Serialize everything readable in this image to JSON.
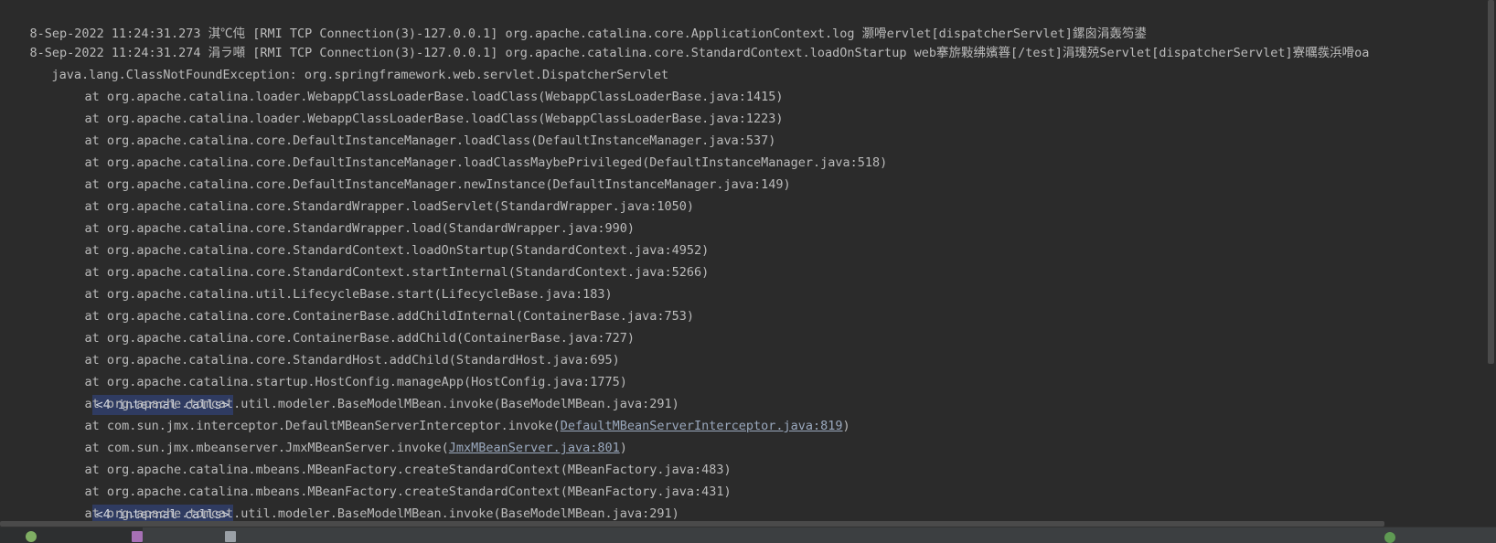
{
  "console": {
    "lines": [
      "8-Sep-2022 11:24:31.273 淇℃伅 [RMI TCP Connection(3)-127.0.0.1] org.apache.catalina.core.ApplicationContext.log 灏嗗ervlet[dispatcherServlet]鏍囪涓轰笉鍙",
      "8-Sep-2022 11:24:31.274 涓ラ噸 [RMI TCP Connection(3)-127.0.0.1] org.apache.catalina.core.StandardContext.loadOnStartup web搴旂敤绋嬪簭[/test]涓瑰殑Servlet[dispatcherServlet]寮曞彂浜嗗oa",
      "java.lang.ClassNotFoundException: org.springframework.web.servlet.DispatcherServlet",
      "at org.apache.catalina.loader.WebappClassLoaderBase.loadClass(WebappClassLoaderBase.java:1415)",
      "at org.apache.catalina.loader.WebappClassLoaderBase.loadClass(WebappClassLoaderBase.java:1223)",
      "at org.apache.catalina.core.DefaultInstanceManager.loadClass(DefaultInstanceManager.java:537)",
      "at org.apache.catalina.core.DefaultInstanceManager.loadClassMaybePrivileged(DefaultInstanceManager.java:518)",
      "at org.apache.catalina.core.DefaultInstanceManager.newInstance(DefaultInstanceManager.java:149)",
      "at org.apache.catalina.core.StandardWrapper.loadServlet(StandardWrapper.java:1050)",
      "at org.apache.catalina.core.StandardWrapper.load(StandardWrapper.java:990)",
      "at org.apache.catalina.core.StandardContext.loadOnStartup(StandardContext.java:4952)",
      "at org.apache.catalina.core.StandardContext.startInternal(StandardContext.java:5266)",
      "at org.apache.catalina.util.LifecycleBase.start(LifecycleBase.java:183)",
      "at org.apache.catalina.core.ContainerBase.addChildInternal(ContainerBase.java:753)",
      "at org.apache.catalina.core.ContainerBase.addChild(ContainerBase.java:727)",
      "at org.apache.catalina.core.StandardHost.addChild(StandardHost.java:695)",
      "at org.apache.catalina.startup.HostConfig.manageApp(HostConfig.java:1775)",
      "at org.apache.tomcat.util.modeler.BaseModelMBean.invoke(BaseModelMBean.java:291)",
      "at com.sun.jmx.interceptor.DefaultMBeanServerInterceptor.invoke(",
      "at com.sun.jmx.mbeanserver.JmxMBeanServer.invoke(",
      "at org.apache.catalina.mbeans.MBeanFactory.createStandardContext(MBeanFactory.java:483)",
      "at org.apache.catalina.mbeans.MBeanFactory.createStandardContext(MBeanFactory.java:431)",
      "at org.apache.tomcat.util.modeler.BaseModelMBean.invoke(BaseModelMBean.java:291)"
    ],
    "internal_calls_label": "<4 internal calls>",
    "link1_text": "DefaultMBeanServerInterceptor.java:819",
    "link2_text": "JmxMBeanServer.java:801",
    "close_paren": ")"
  }
}
